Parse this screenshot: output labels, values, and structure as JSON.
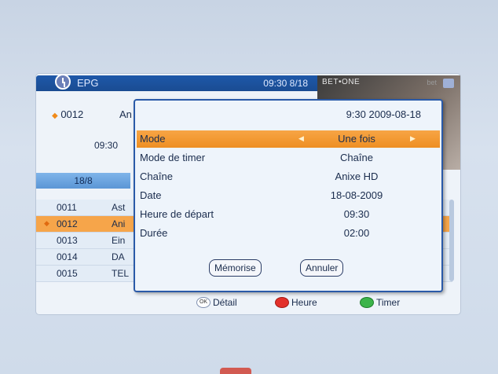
{
  "header": {
    "title": "EPG",
    "clock_date": "09:30 8/18"
  },
  "preview": {
    "logo": "BET•ONE",
    "faint": "bet"
  },
  "current": {
    "number": "0012",
    "name": "An",
    "time": "09:30"
  },
  "datebar": "18/8",
  "channels": [
    {
      "number": "0011",
      "name": "Ast",
      "selected": false
    },
    {
      "number": "0012",
      "name": "Ani",
      "selected": true
    },
    {
      "number": "0013",
      "name": "Ein",
      "selected": false
    },
    {
      "number": "0014",
      "name": "DA",
      "selected": false
    },
    {
      "number": "0015",
      "name": "TEL",
      "selected": false
    }
  ],
  "dialog": {
    "datetime": "9:30 2009-08-18",
    "fields": [
      {
        "label": "Mode",
        "value": "Une fois"
      },
      {
        "label": "Mode de timer",
        "value": "Chaîne"
      },
      {
        "label": "Chaîne",
        "value": "Anixe HD"
      },
      {
        "label": "Date",
        "value": "18-08-2009"
      },
      {
        "label": "Heure de départ",
        "value": "09:30"
      },
      {
        "label": "Durée",
        "value": "02:00"
      }
    ],
    "save_label": "Mémorise",
    "cancel_label": "Annuler"
  },
  "footer": {
    "ok_glyph": "OK",
    "detail_label": "Détail",
    "hour_label": "Heure",
    "timer_label": "Timer"
  },
  "colors": {
    "accent": "#ee8f22",
    "header_blue": "#1e58a9",
    "red_key": "#e3302a",
    "green_key": "#3cb44a"
  }
}
